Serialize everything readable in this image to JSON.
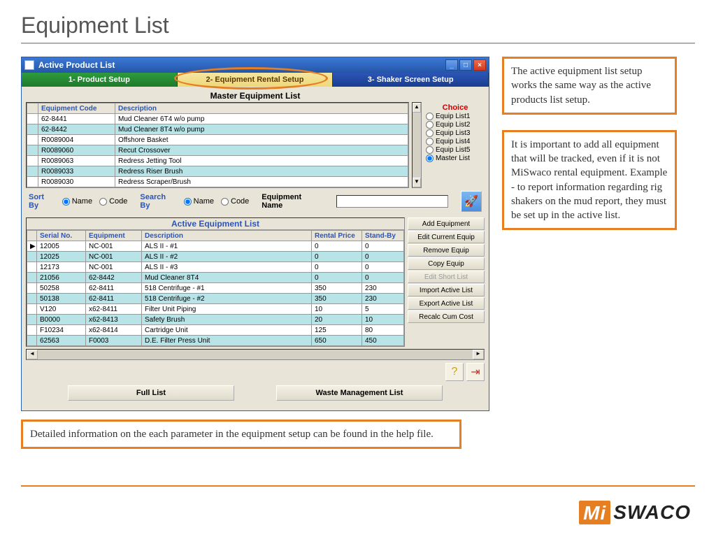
{
  "slide_title": "Equipment List",
  "window": {
    "title": "Active Product List",
    "tabs": [
      "1- Product Setup",
      "2- Equipment Rental Setup",
      "3- Shaker Screen Setup"
    ],
    "master_section_title": "Master Equipment List",
    "choice": {
      "title": "Choice",
      "options": [
        "Equip List1",
        "Equip List2",
        "Equip List3",
        "Equip List4",
        "Equip List5",
        "Master List"
      ],
      "selected": "Master List"
    },
    "master_headers": [
      "Equipment Code",
      "Description"
    ],
    "master_rows": [
      {
        "code": "62-8441",
        "desc": "Mud Cleaner 6T4 w/o pump"
      },
      {
        "code": "62-8442",
        "desc": "Mud Cleaner 8T4 w/o pump"
      },
      {
        "code": "R0089004",
        "desc": "Offshore Basket"
      },
      {
        "code": "R0089060",
        "desc": "Recut Crossover"
      },
      {
        "code": "R0089063",
        "desc": "Redress Jetting Tool"
      },
      {
        "code": "R0089033",
        "desc": "Redress Riser Brush"
      },
      {
        "code": "R0089030",
        "desc": "Redress Scraper/Brush"
      }
    ],
    "sort_by_label": "Sort By",
    "search_by_label": "Search By",
    "radio_options": [
      "Name",
      "Code"
    ],
    "equipment_name_label": "Equipment Name",
    "active_section_title": "Active Equipment List",
    "active_headers": [
      "Serial No.",
      "Equipment",
      "Description",
      "Rental Price",
      "Stand-By"
    ],
    "active_rows": [
      {
        "m": "▶",
        "sn": "12005",
        "eq": "NC-001",
        "desc": "ALS II - #1",
        "rp": "0",
        "sb": "0"
      },
      {
        "m": "",
        "sn": "12025",
        "eq": "NC-001",
        "desc": "ALS II - #2",
        "rp": "0",
        "sb": "0"
      },
      {
        "m": "",
        "sn": "12173",
        "eq": "NC-001",
        "desc": "ALS II - #3",
        "rp": "0",
        "sb": "0"
      },
      {
        "m": "",
        "sn": "21056",
        "eq": "62-8442",
        "desc": "Mud Cleaner 8T4",
        "rp": "0",
        "sb": "0"
      },
      {
        "m": "",
        "sn": "50258",
        "eq": "62-8411",
        "desc": "518 Centrifuge - #1",
        "rp": "350",
        "sb": "230"
      },
      {
        "m": "",
        "sn": "50138",
        "eq": "62-8411",
        "desc": "518 Centrifuge - #2",
        "rp": "350",
        "sb": "230"
      },
      {
        "m": "",
        "sn": "V120",
        "eq": "x62-8411",
        "desc": "Filter Unit Piping",
        "rp": "10",
        "sb": "5"
      },
      {
        "m": "",
        "sn": "B0000",
        "eq": "x62-8413",
        "desc": "Safety Brush",
        "rp": "20",
        "sb": "10"
      },
      {
        "m": "",
        "sn": "F10234",
        "eq": "x62-8414",
        "desc": "Cartridge Unit",
        "rp": "125",
        "sb": "80"
      },
      {
        "m": "",
        "sn": "62563",
        "eq": "F0003",
        "desc": "D.E. Filter Press Unit",
        "rp": "650",
        "sb": "450"
      }
    ],
    "action_buttons": [
      "Add Equipment",
      "Edit Current Equip",
      "Remove Equip",
      "Copy Equip",
      "Edit Short List",
      "Import Active List",
      "Export Active List",
      "Recalc Cum Cost"
    ],
    "full_list_btn": "Full List",
    "waste_btn": "Waste Management List"
  },
  "callouts": {
    "top_right": "The active equipment list setup works the same way as the active products list setup.",
    "mid_right": "It is important to add all equipment that will be tracked, even if it is not MiSwaco rental equipment.  Example - to report information regarding  rig shakers on the mud report, they must be set up in the active list.",
    "bottom": "Detailed information on the each parameter in the equipment setup can be found in the help file."
  },
  "logo": {
    "mi": "Mi",
    "swaco": "SWACO"
  }
}
